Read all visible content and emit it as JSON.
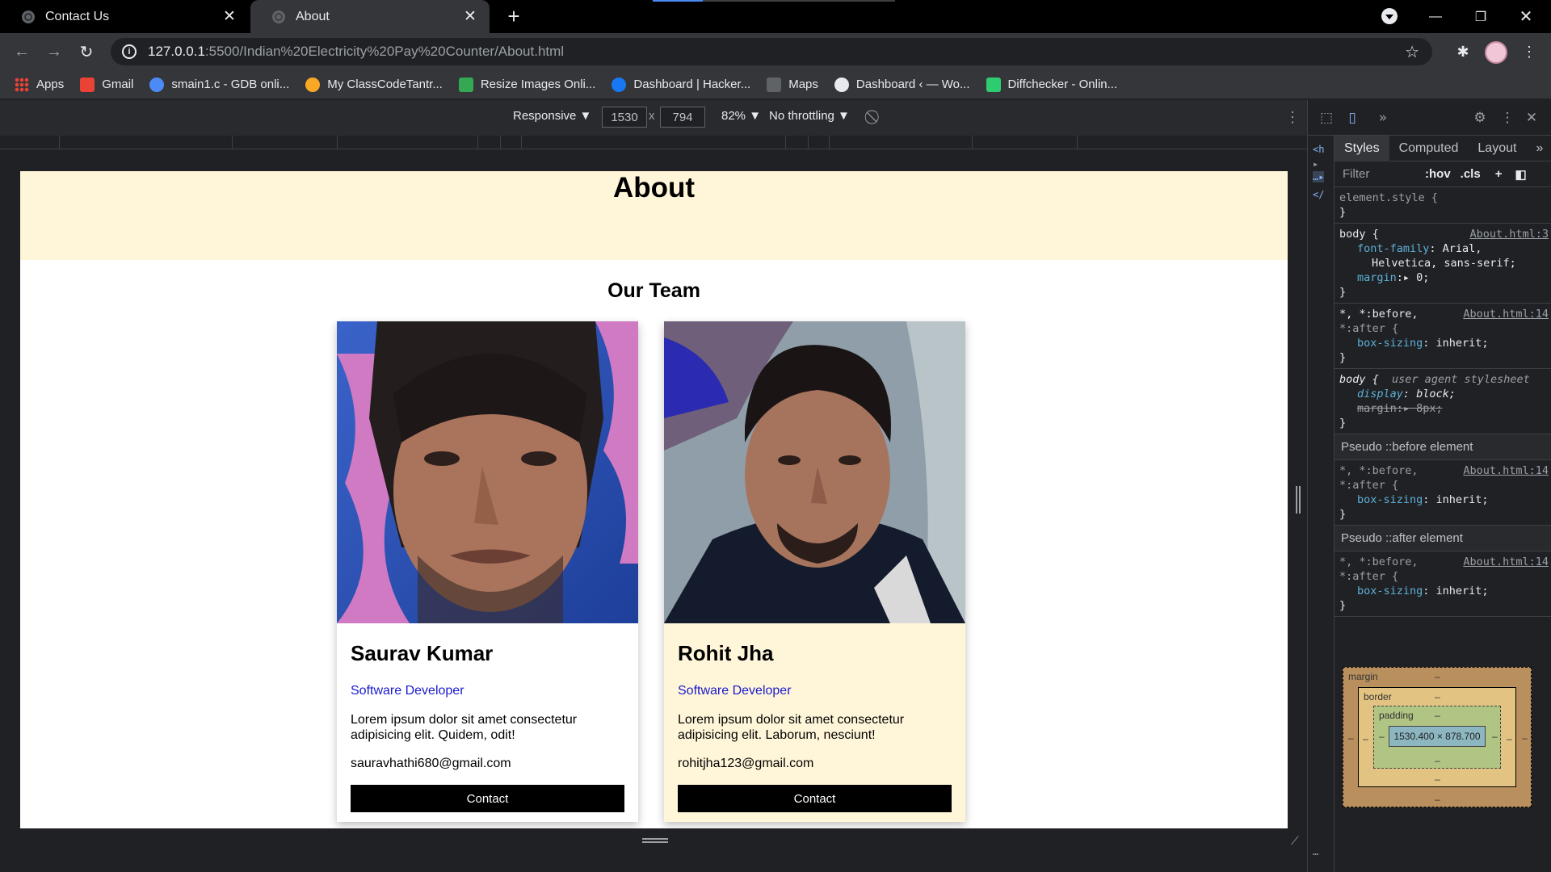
{
  "tabs": [
    {
      "label": "Contact Us",
      "active": false
    },
    {
      "label": "About",
      "active": true
    }
  ],
  "address": {
    "host": "127.0.0.1",
    "path": ":5500/Indian%20Electricity%20Pay%20Counter/About.html"
  },
  "bookmarks": [
    {
      "label": "Apps",
      "color": "#4285f4"
    },
    {
      "label": "Gmail",
      "color": "#ea4335"
    },
    {
      "label": "smain1.c - GDB onli...",
      "color": "#4c8bf5"
    },
    {
      "label": "My ClassCodeTantr...",
      "color": "#f9a825"
    },
    {
      "label": "Resize Images Onli...",
      "color": "#34a853"
    },
    {
      "label": "Dashboard | Hacker...",
      "color": "#1877f2"
    },
    {
      "label": "Maps",
      "color": "#5f6368"
    },
    {
      "label": "Dashboard ‹ — Wo...",
      "color": "#e8eaed"
    },
    {
      "label": "Diffchecker - Onlin...",
      "color": "#2ecc71"
    }
  ],
  "device_toolbar": {
    "mode": "Responsive ▼",
    "width": "1530",
    "height": "794",
    "times": "x",
    "zoom": "82% ▼",
    "throttling": "No throttling ▼"
  },
  "page": {
    "title": "About",
    "team_heading": "Our Team",
    "members": [
      {
        "name": "Saurav Kumar",
        "role": "Software Developer",
        "description": "Lorem ipsum dolor sit amet consectetur adipisicing elit. Quidem, odit!",
        "email": "sauravhathi680@gmail.com",
        "button": "Contact",
        "card_bg": "#ffffff"
      },
      {
        "name": "Rohit Jha",
        "role": "Software Developer",
        "description": "Lorem ipsum dolor sit amet consectetur adipisicing elit. Laborum, nesciunt!",
        "email": "rohitjha123@gmail.com",
        "button": "Contact",
        "card_bg": "#fff6d9"
      }
    ]
  },
  "devtools": {
    "subtabs": [
      "Styles",
      "Computed",
      "Layout"
    ],
    "filter_placeholder": "Filter",
    "hov": ":hov",
    "cls": ".cls",
    "rules": {
      "element_style": "element.style {",
      "close": "}",
      "body_sel": "body {",
      "body_src": "About.html:3",
      "ff_prop": "font-family",
      "ff_val": ": Arial,",
      "ff_val2": "Helvetica, sans-serif;",
      "margin_prop": "margin",
      "margin_val": ":▸ 0;",
      "star_sel": "*, *:before,",
      "star_sel2": "*:after {",
      "star_src": "About.html:14",
      "bs_prop": "box-sizing",
      "bs_val": ": inherit;",
      "ua_sel": "body {",
      "ua_note": "user agent stylesheet",
      "disp_prop": "display",
      "disp_val": ": block;",
      "ua_margin": "margin:▸ 8px;"
    },
    "pseudo_before": "Pseudo ::before element",
    "pseudo_after": "Pseudo ::after element",
    "box_model": {
      "margin": "margin",
      "border": "border",
      "padding": "padding",
      "content": "1530.400 × 878.700",
      "dash": "–"
    }
  }
}
